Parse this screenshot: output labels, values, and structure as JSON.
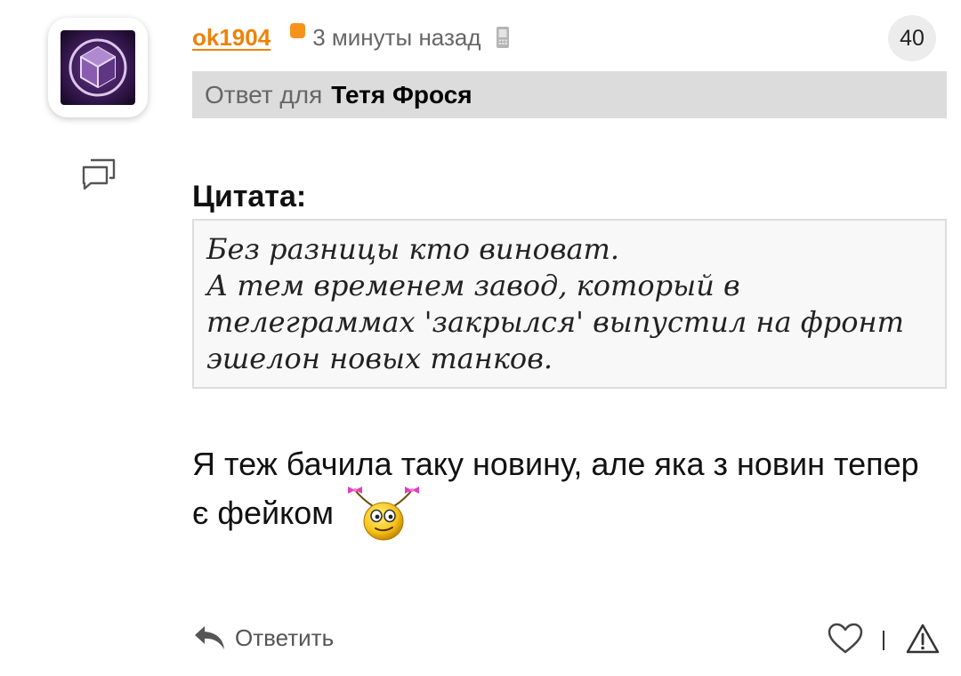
{
  "comment": {
    "username": "ok1904",
    "time_ago": "3 минуты назад",
    "count": "40",
    "reply_to_prefix": "Ответ для",
    "reply_to_name": "Тетя Фрося",
    "quote_label": "Цитата:",
    "quote_text": "Без разницы кто виноват.\nА тем временем завод, который в телеграммах 'закрылся' выпустил на фронт эшелон новых танков.",
    "message": "Я теж бачила таку новину, але яка з новин тепер є фейком"
  },
  "actions": {
    "reply_label": "Ответить"
  },
  "icons": {
    "avatar": "cube-logo-avatar",
    "thread": "thread-icon",
    "status": "online-status-dot",
    "device": "mobile-phone-icon",
    "smiley": "girl-smiley-emoticon",
    "reply": "reply-arrow-icon",
    "like": "heart-icon",
    "report": "warning-icon"
  },
  "colors": {
    "username": "#ee8208",
    "status_dot": "#f7931a",
    "reply_bar_bg": "#dcdcdc",
    "quote_bg": "#f8f8f8",
    "badge_bg": "#ececec"
  }
}
